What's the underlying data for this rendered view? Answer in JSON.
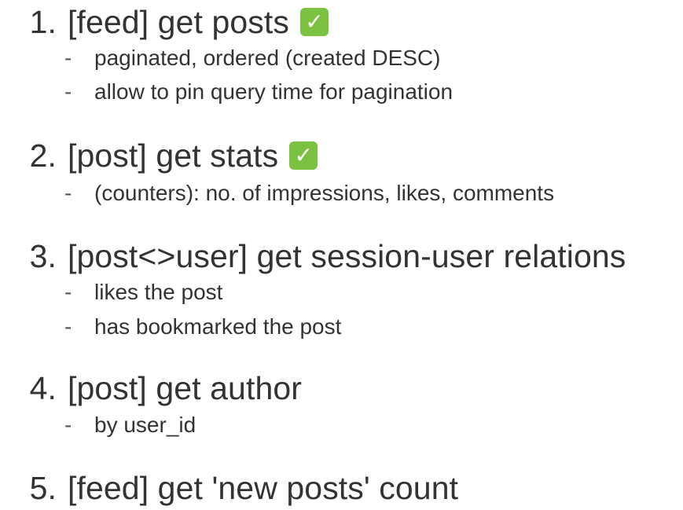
{
  "items": [
    {
      "number": "1.",
      "title": "[feed] get posts",
      "done": true,
      "done_glyph": "✓",
      "subs": [
        "paginated, ordered (created DESC)",
        "allow to pin query time for pagination"
      ]
    },
    {
      "number": "2.",
      "title": "[post] get stats",
      "done": true,
      "done_glyph": "✓",
      "subs": [
        "(counters): no. of impressions, likes, comments"
      ]
    },
    {
      "number": "3.",
      "title": "[post<>user] get session-user relations",
      "done": false,
      "subs": [
        "likes the post",
        "has bookmarked the post"
      ]
    },
    {
      "number": "4.",
      "title": "[post] get author",
      "done": false,
      "subs": [
        "by user_id"
      ]
    },
    {
      "number": "5.",
      "title": "[feed] get 'new posts' count",
      "done": false,
      "subs": []
    }
  ],
  "sub_bullet": "-",
  "colors": {
    "text": "#333333",
    "checkmark_bg": "#7cc242",
    "checkmark_fg": "#ffffff"
  },
  "icons": {
    "done": "white-check-mark-icon"
  }
}
